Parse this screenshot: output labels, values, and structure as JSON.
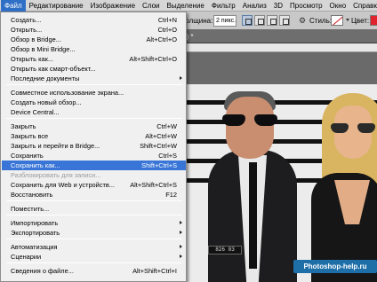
{
  "menubar": {
    "items": [
      "Файл",
      "Редактирование",
      "Изображение",
      "Слои",
      "Выделение",
      "Фильтр",
      "Анализ",
      "3D",
      "Просмотр",
      "Окно",
      "Справка"
    ],
    "active_index": 0
  },
  "options_bar": {
    "thickness_label": "Толщина:",
    "thickness_value": "2 пикс.",
    "style_label": "Стиль:",
    "color_label": "Цвет:",
    "color": "#e0232c"
  },
  "document": {
    "tab_title": "8) *",
    "plate_text": "826 83",
    "watermark": "Photoshop-help.ru"
  },
  "file_menu": {
    "groups": [
      [
        {
          "label": "Создать...",
          "shortcut": "Ctrl+N"
        },
        {
          "label": "Открыть...",
          "shortcut": "Ctrl+O"
        },
        {
          "label": "Обзор в Bridge...",
          "shortcut": "Alt+Ctrl+O"
        },
        {
          "label": "Обзор в Mini Bridge...",
          "shortcut": ""
        },
        {
          "label": "Открыть как...",
          "shortcut": "Alt+Shift+Ctrl+O"
        },
        {
          "label": "Открыть как смарт-объект...",
          "shortcut": ""
        },
        {
          "label": "Последние документы",
          "shortcut": "",
          "submenu": true
        }
      ],
      [
        {
          "label": "Совместное использование экрана...",
          "shortcut": ""
        },
        {
          "label": "Создать новый обзор...",
          "shortcut": ""
        },
        {
          "label": "Device Central...",
          "shortcut": ""
        }
      ],
      [
        {
          "label": "Закрыть",
          "shortcut": "Ctrl+W"
        },
        {
          "label": "Закрыть все",
          "shortcut": "Alt+Ctrl+W"
        },
        {
          "label": "Закрыть и перейти в Bridge...",
          "shortcut": "Shift+Ctrl+W"
        },
        {
          "label": "Сохранить",
          "shortcut": "Ctrl+S"
        },
        {
          "label": "Сохранить как...",
          "shortcut": "Shift+Ctrl+S",
          "highlighted": true
        },
        {
          "label": "Разблокировать для записи...",
          "shortcut": "",
          "disabled": true
        },
        {
          "label": "Сохранить для Web и устройств...",
          "shortcut": "Alt+Shift+Ctrl+S"
        },
        {
          "label": "Восстановить",
          "shortcut": "F12"
        }
      ],
      [
        {
          "label": "Поместить...",
          "shortcut": ""
        }
      ],
      [
        {
          "label": "Импортировать",
          "shortcut": "",
          "submenu": true
        },
        {
          "label": "Экспортировать",
          "shortcut": "",
          "submenu": true
        }
      ],
      [
        {
          "label": "Автоматизация",
          "shortcut": "",
          "submenu": true
        },
        {
          "label": "Сценарии",
          "shortcut": "",
          "submenu": true
        }
      ],
      [
        {
          "label": "Сведения о файле...",
          "shortcut": "Alt+Shift+Ctrl+I"
        }
      ]
    ]
  }
}
